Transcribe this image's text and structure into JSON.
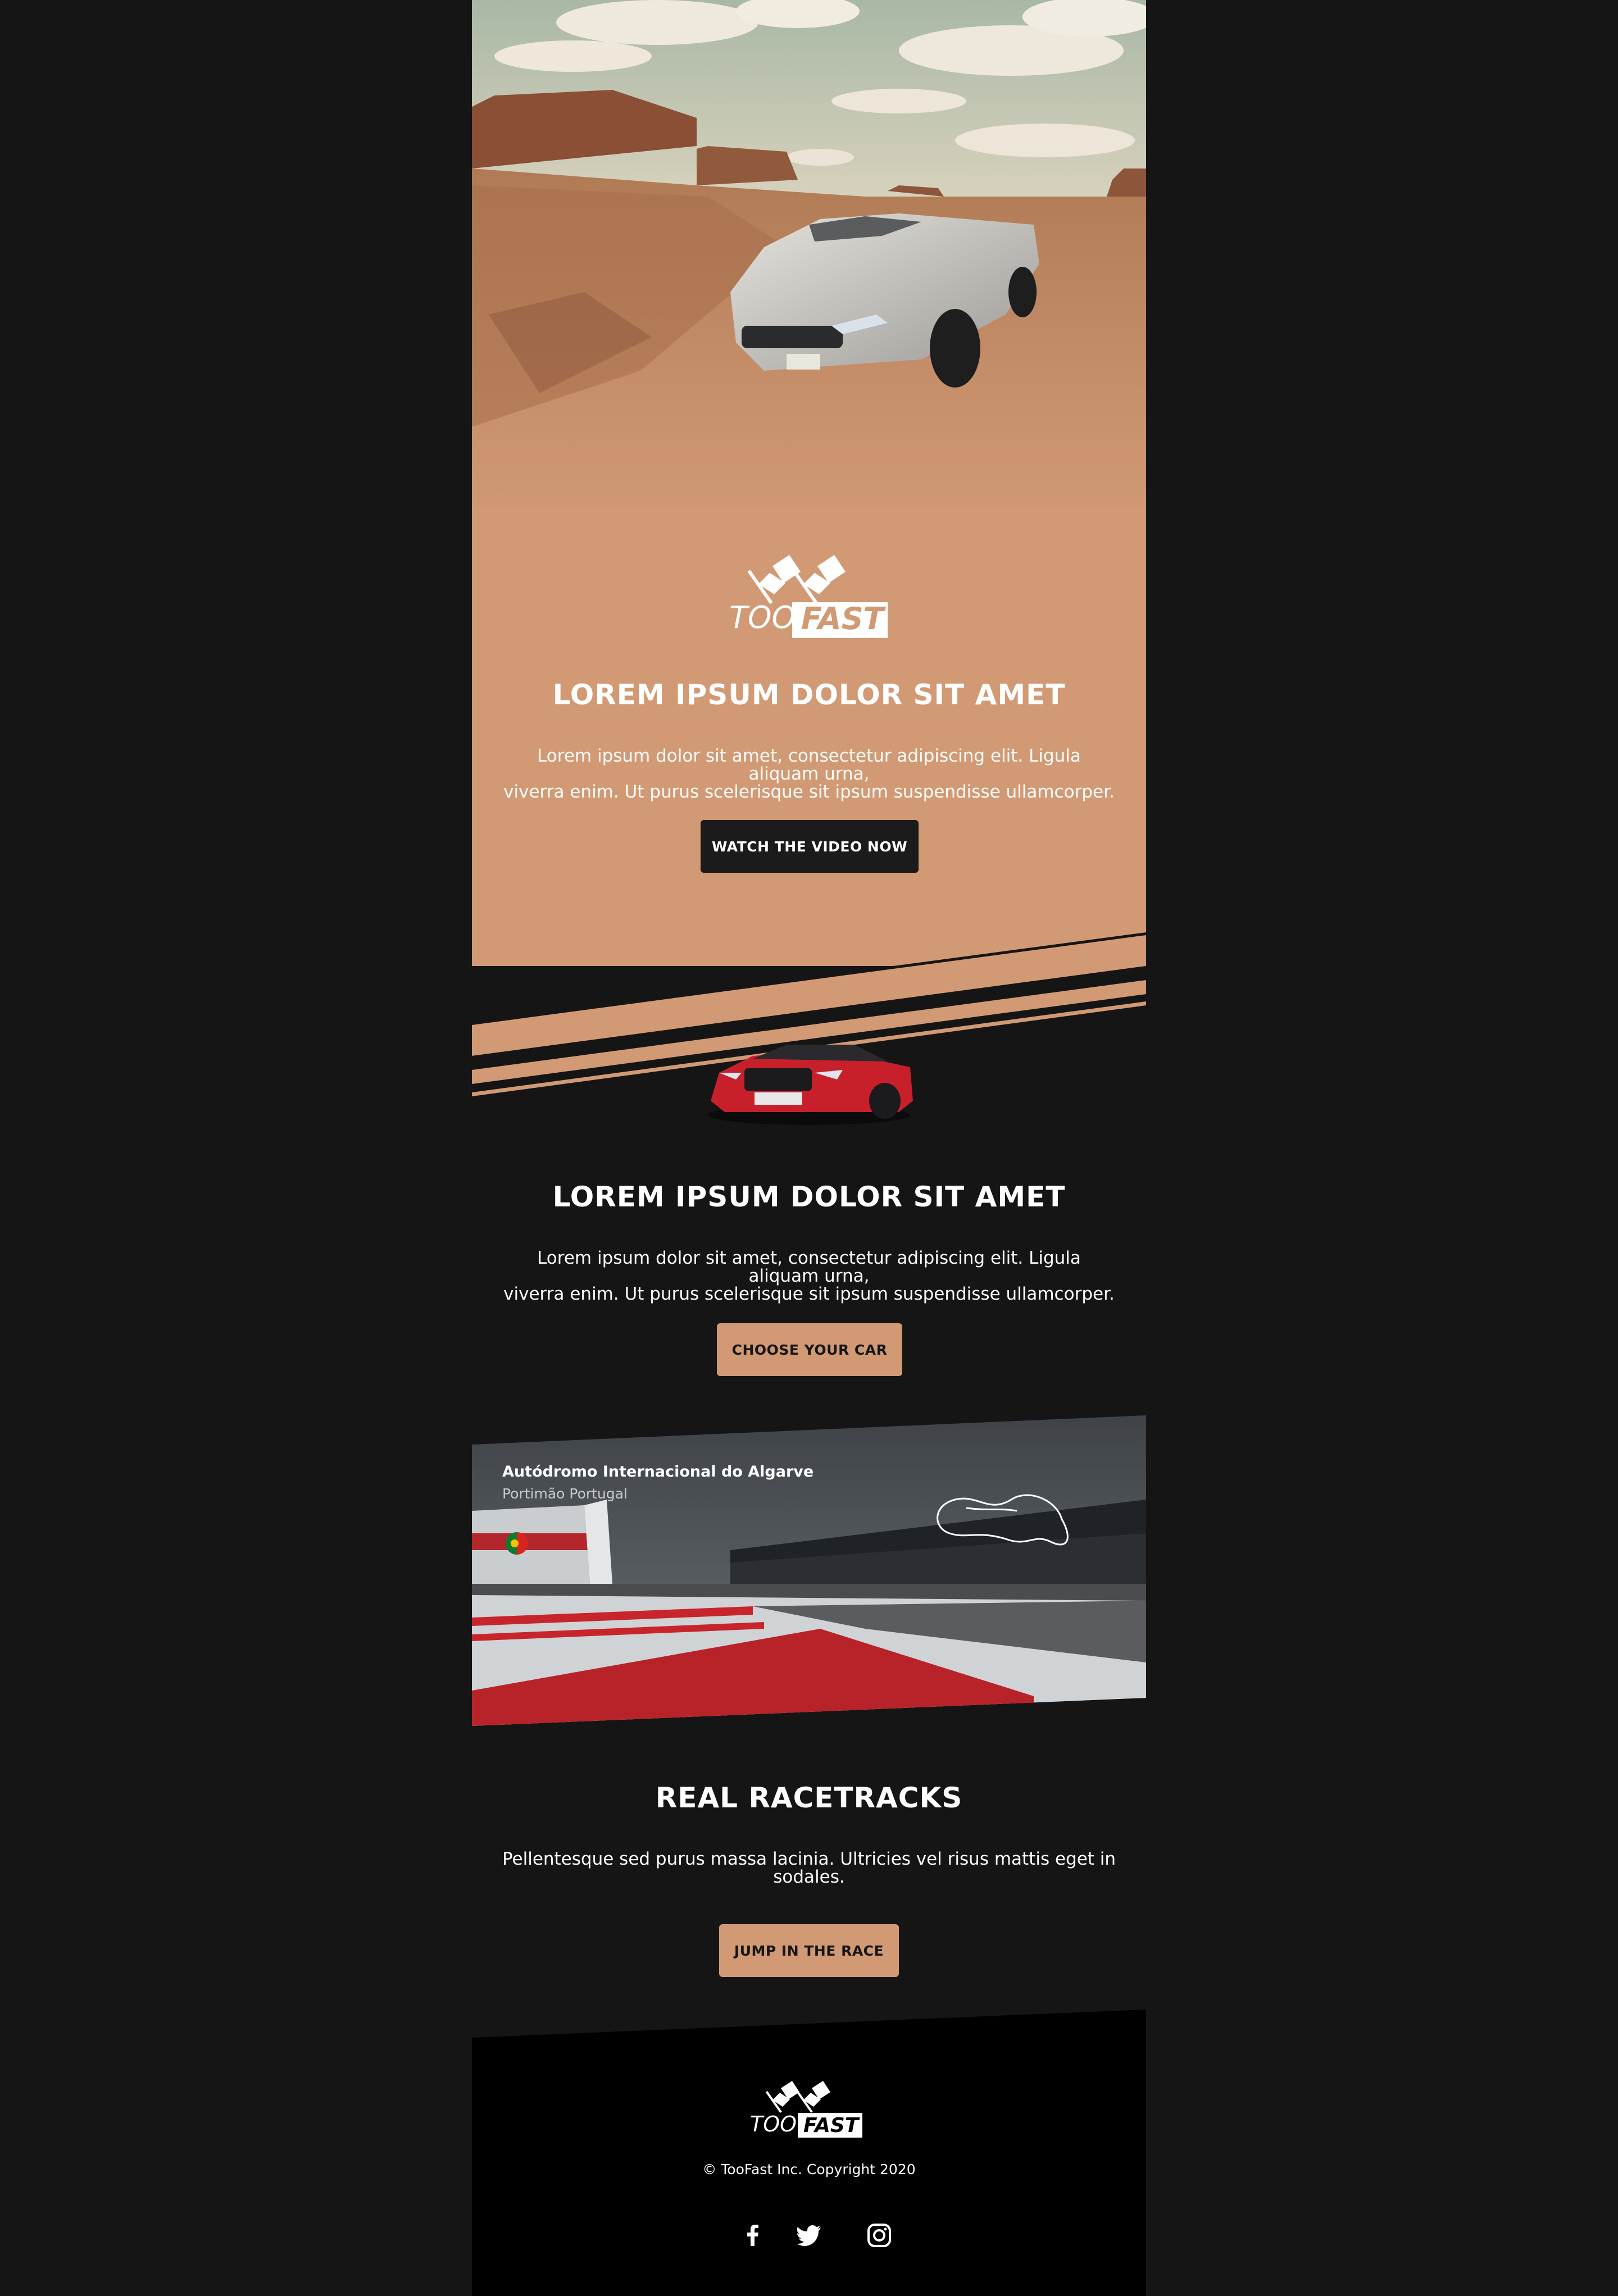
{
  "brand": {
    "logo_word_1": "TOO",
    "logo_word_2": "FAST"
  },
  "colors": {
    "page_bg": "#151515",
    "accent_tan": "#d19a74",
    "dark_button": "#1b1b1b",
    "footer_bg": "#000000"
  },
  "hero": {
    "title": "LOREM IPSUM DOLOR SIT AMET",
    "body_line_1": "Lorem ipsum dolor sit amet, consectetur adipiscing elit. Ligula aliquam urna,",
    "body_line_2": "viverra enim. Ut purus scelerisque sit ipsum suspendisse ullamcorper.",
    "cta": "WATCH THE VIDEO NOW"
  },
  "section2": {
    "title": "LOREM IPSUM DOLOR SIT AMET",
    "body_line_1": "Lorem ipsum dolor sit amet, consectetur adipiscing elit. Ligula aliquam urna,",
    "body_line_2": "viverra enim. Ut purus scelerisque sit ipsum suspendisse ullamcorper.",
    "cta": "CHOOSE YOUR CAR"
  },
  "track": {
    "name": "Autódromo Internacional do Algarve",
    "location": "Portimão Portugal",
    "flag_icon": "portugal-flag-icon"
  },
  "section3": {
    "title": "REAL RACETRACKS",
    "body_line_1": "Pellentesque sed purus massa lacinia. Ultricies vel risus mattis eget in",
    "body_line_2": "sodales.",
    "cta": "JUMP IN THE RACE"
  },
  "footer": {
    "copyright": "© TooFast Inc. Copyright 2020",
    "social": [
      "facebook-icon",
      "twitter-icon",
      "instagram-icon"
    ]
  }
}
